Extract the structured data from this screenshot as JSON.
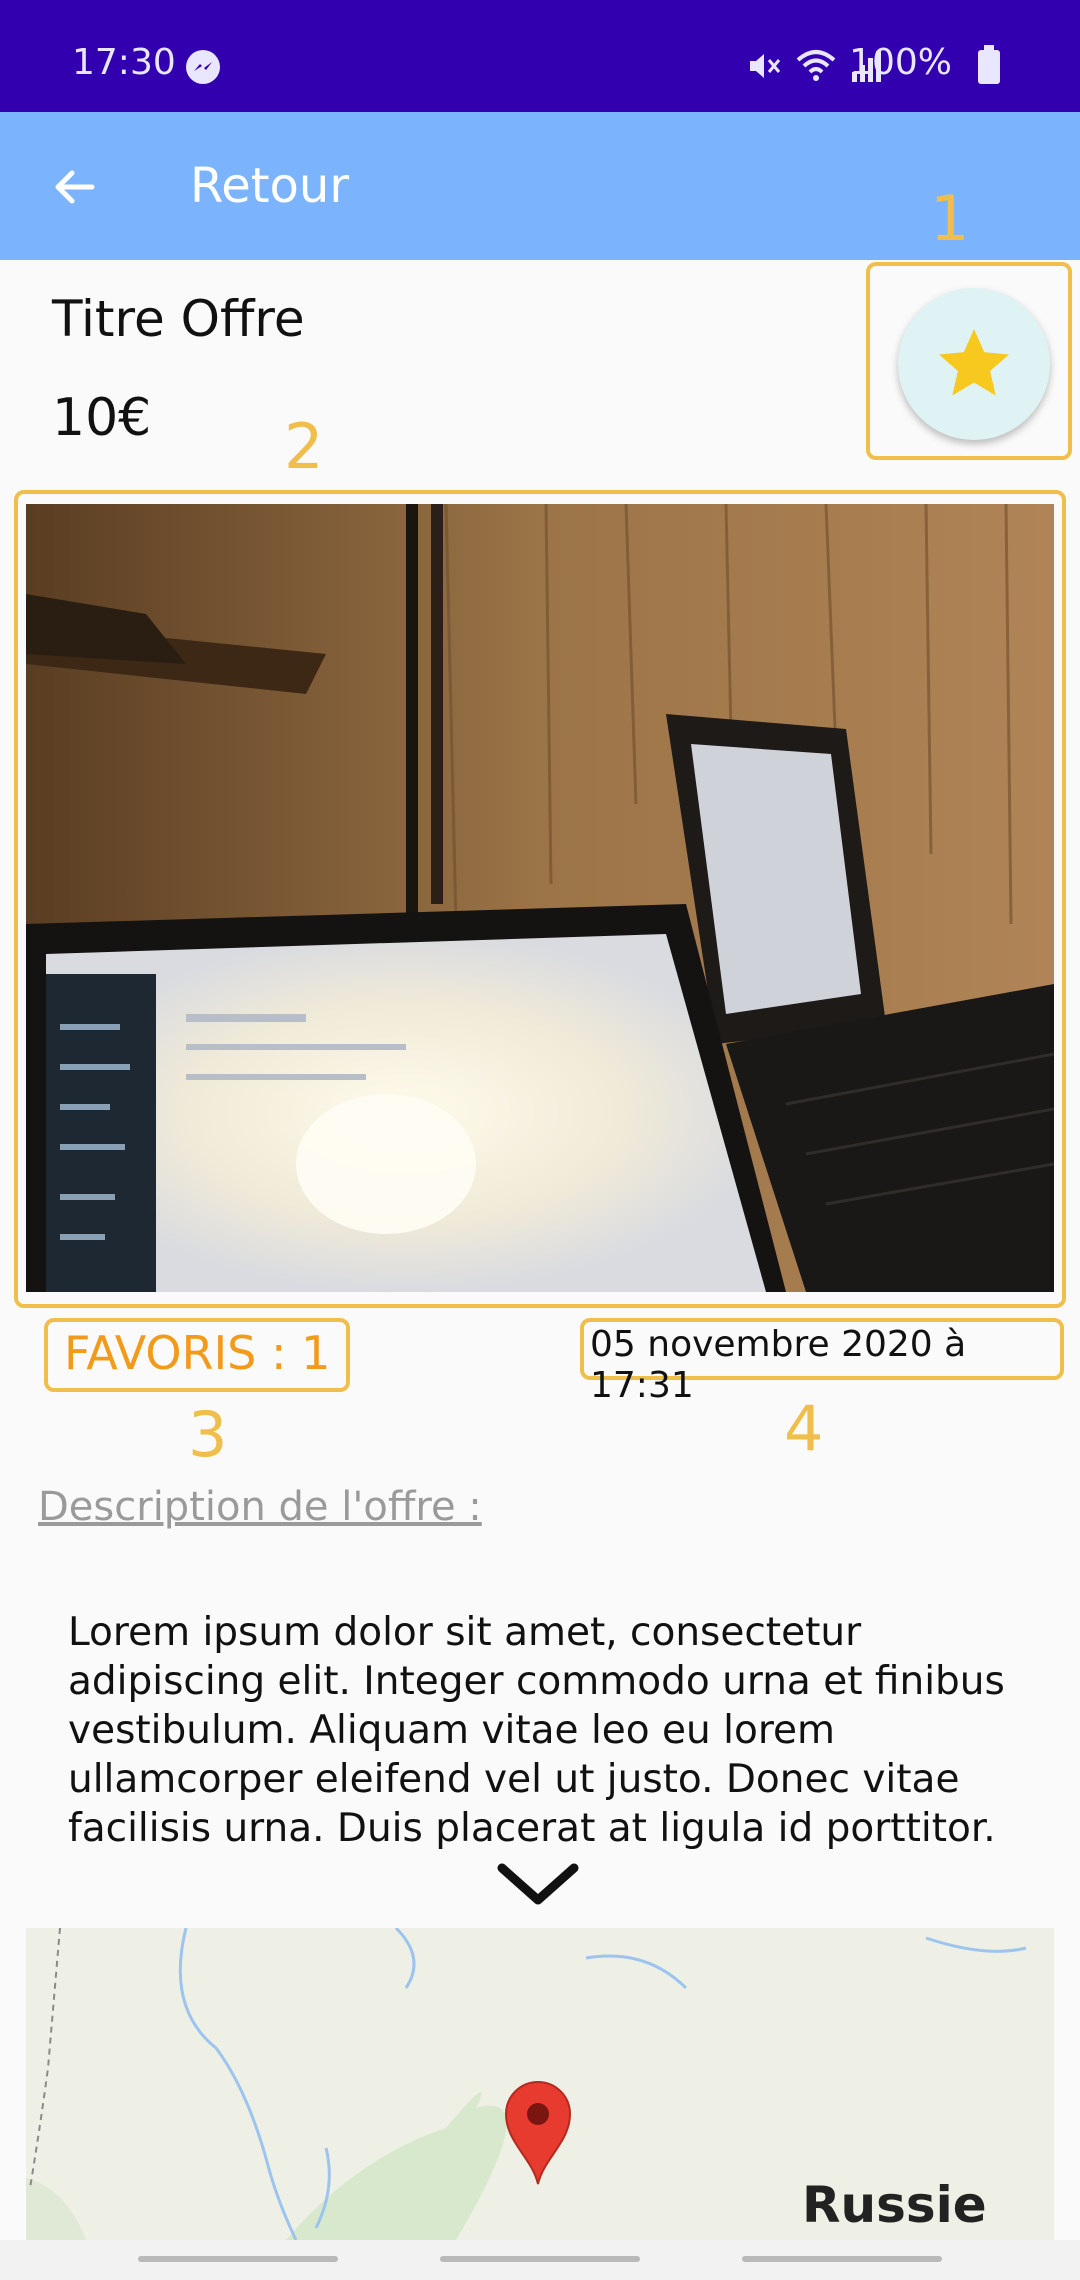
{
  "status_bar": {
    "time": "17:30",
    "battery": "100%",
    "icons": [
      "messenger-icon",
      "mute-icon",
      "wifi-icon",
      "signal-icon",
      "battery-icon"
    ]
  },
  "app_bar": {
    "back_icon": "arrow-left-icon",
    "title": "Retour"
  },
  "offer": {
    "title": "Titre Offre",
    "price": "10€",
    "favorite_icon": "star-icon",
    "favorites_count": "FAVORIS : 1",
    "date": "05 novembre 2020 à 17:31",
    "description_label": "Description de l'offre :",
    "description": " Lorem ipsum dolor sit amet, consectetur adipiscing elit. Integer commodo urna et finibus vestibulum. Aliquam vitae leo eu lorem ullamcorper eleifend vel ut justo. Donec vitae facilisis urna. Duis placerat at ligula id porttitor.",
    "expand_icon": "chevron-down-icon"
  },
  "map": {
    "label": "Russie",
    "pin_icon": "map-pin-icon"
  },
  "annotations": {
    "n1": "1",
    "n2": "2",
    "n3": "3",
    "n4": "4"
  },
  "colors": {
    "status_bar": "#3300b0",
    "app_bar": "#7bb4fd",
    "annotation": "#f0be4a",
    "favorites_text": "#f29a1a",
    "star": "#f7c81e"
  }
}
